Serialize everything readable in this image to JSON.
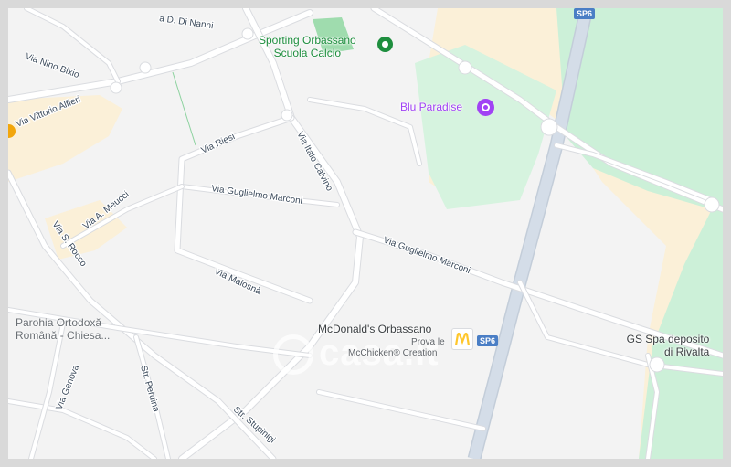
{
  "map": {
    "pois": {
      "sporting": {
        "line1": "Sporting Orbassano",
        "line2": "Scuola Calcio",
        "icon": "sports-pin-icon",
        "color": "#1e8e3e"
      },
      "blu_paradise": {
        "label": "Blu Paradise",
        "icon": "entertainment-pin-icon",
        "color": "#a142f4"
      },
      "mcdonalds": {
        "name": "McDonald's Orbassano",
        "promo_line1": "Prova le",
        "promo_line2": "McChicken® Creation",
        "icon": "mcdonalds-logo-icon"
      },
      "gs_spa": {
        "line1": "GS Spa deposito",
        "line2": "di Rivalta"
      },
      "parohia": {
        "line1": "Parohia Ortodoxă",
        "line2": "Română - Chiesa..."
      }
    },
    "route_shields": {
      "top": "SP6",
      "middle": "SP6"
    },
    "streets": {
      "di_nanni": "a D. Di Nanni",
      "nino_bixio": "Via Nino Bixio",
      "vittorio_alfieri": "Via Vittorio Alfieri",
      "riesi": "Via Riesi",
      "italo_calvino": "Via Italo Calvino",
      "marconi_1": "Via Guglielmo Marconi",
      "marconi_2": "Via Guglielmo Marconi",
      "meucci": "Via A. Meucci",
      "s_rocco": "Via S. Rocco",
      "malosna": "Via Malosnà",
      "genova": "Via Genova",
      "perdina": "Str. Perdina",
      "stupinigi": "Str. Stupinigi"
    },
    "watermark": "casa.it",
    "colors": {
      "background": "#f3f3f3",
      "park": "#ccf0d8",
      "commercial": "#fbf0d8",
      "road": "#ffffff",
      "highway": "#d4dde8"
    }
  }
}
